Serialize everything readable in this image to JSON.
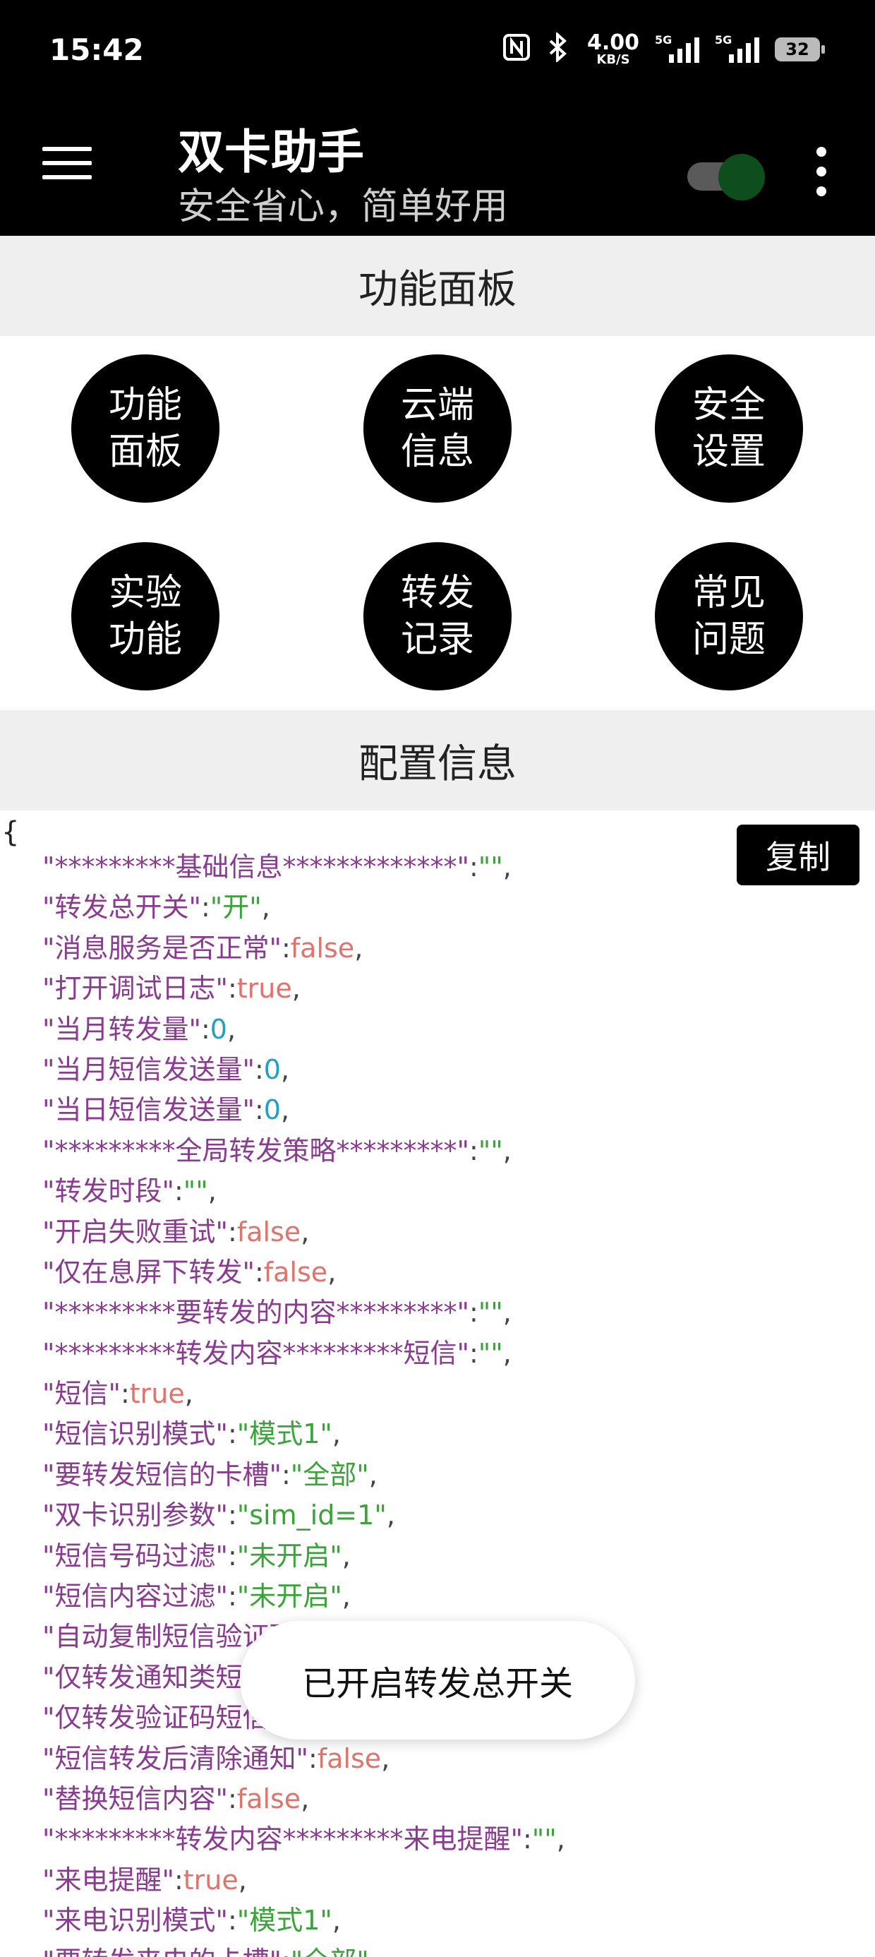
{
  "status_bar": {
    "time": "15:42",
    "net_speed_value": "4.00",
    "net_speed_unit": "KB/S",
    "sim1_label": "5G",
    "sim2_label": "5G",
    "battery": "32"
  },
  "app_bar": {
    "title": "双卡助手",
    "subtitle": "安全省心，简单好用",
    "toggle_on": true,
    "toggle_color": "#0d4d1e"
  },
  "panel": {
    "header": "功能面板",
    "buttons": [
      {
        "label": "功能面板"
      },
      {
        "label": "云端信息"
      },
      {
        "label": "安全设置"
      },
      {
        "label": "实验功能"
      },
      {
        "label": "转发记录"
      },
      {
        "label": "常见问题"
      }
    ]
  },
  "config": {
    "header": "配置信息",
    "open_brace": "{",
    "copy_label": "复制",
    "lines": [
      {
        "key": "\"*********基础信息*************\"",
        "value": "\"\"",
        "type": "str"
      },
      {
        "key": "\"转发总开关\"",
        "value": "\"开\"",
        "type": "str"
      },
      {
        "key": "\"消息服务是否正常\"",
        "value": "false",
        "type": "false"
      },
      {
        "key": "\"打开调试日志\"",
        "value": "true",
        "type": "true"
      },
      {
        "key": "\"当月转发量\"",
        "value": "0",
        "type": "num"
      },
      {
        "key": "\"当月短信发送量\"",
        "value": "0",
        "type": "num"
      },
      {
        "key": "\"当日短信发送量\"",
        "value": "0",
        "type": "num"
      },
      {
        "key": "\"*********全局转发策略*********\"",
        "value": "\"\"",
        "type": "str"
      },
      {
        "key": "\"转发时段\"",
        "value": "\"\"",
        "type": "str"
      },
      {
        "key": "\"开启失败重试\"",
        "value": "false",
        "type": "false"
      },
      {
        "key": "\"仅在息屏下转发\"",
        "value": "false",
        "type": "false"
      },
      {
        "key": "\"*********要转发的内容*********\"",
        "value": "\"\"",
        "type": "str"
      },
      {
        "key": "\"*********转发内容*********短信\"",
        "value": "\"\"",
        "type": "str"
      },
      {
        "key": "\"短信\"",
        "value": "true",
        "type": "true"
      },
      {
        "key": "\"短信识别模式\"",
        "value": "\"模式1\"",
        "type": "str"
      },
      {
        "key": "\"要转发短信的卡槽\"",
        "value": "\"全部\"",
        "type": "str"
      },
      {
        "key": "\"双卡识别参数\"",
        "value": "\"sim_id=1\"",
        "type": "str"
      },
      {
        "key": "\"短信号码过滤\"",
        "value": "\"未开启\"",
        "type": "str"
      },
      {
        "key": "\"短信内容过滤\"",
        "value": "\"未开启\"",
        "type": "str"
      },
      {
        "key": "\"自动复制短信验证码\"",
        "value": "",
        "type": "str"
      },
      {
        "key": "\"仅转发通知类短信\"",
        "value": "",
        "type": "str"
      },
      {
        "key": "\"仅转发验证码短信\"",
        "value": "",
        "type": "str"
      },
      {
        "key": "\"短信转发后清除通知\"",
        "value": "false",
        "type": "false"
      },
      {
        "key": "\"替换短信内容\"",
        "value": "false",
        "type": "false"
      },
      {
        "key": "\"*********转发内容*********来电提醒\"",
        "value": "\"\"",
        "type": "str"
      },
      {
        "key": "\"来电提醒\"",
        "value": "true",
        "type": "true"
      },
      {
        "key": "\"来电识别模式\"",
        "value": "\"模式1\"",
        "type": "str"
      },
      {
        "key": "\"要转发来电的卡槽\"",
        "value": "\"全部\"",
        "type": "str"
      }
    ]
  },
  "toast": {
    "message": "已开启转发总开关"
  }
}
